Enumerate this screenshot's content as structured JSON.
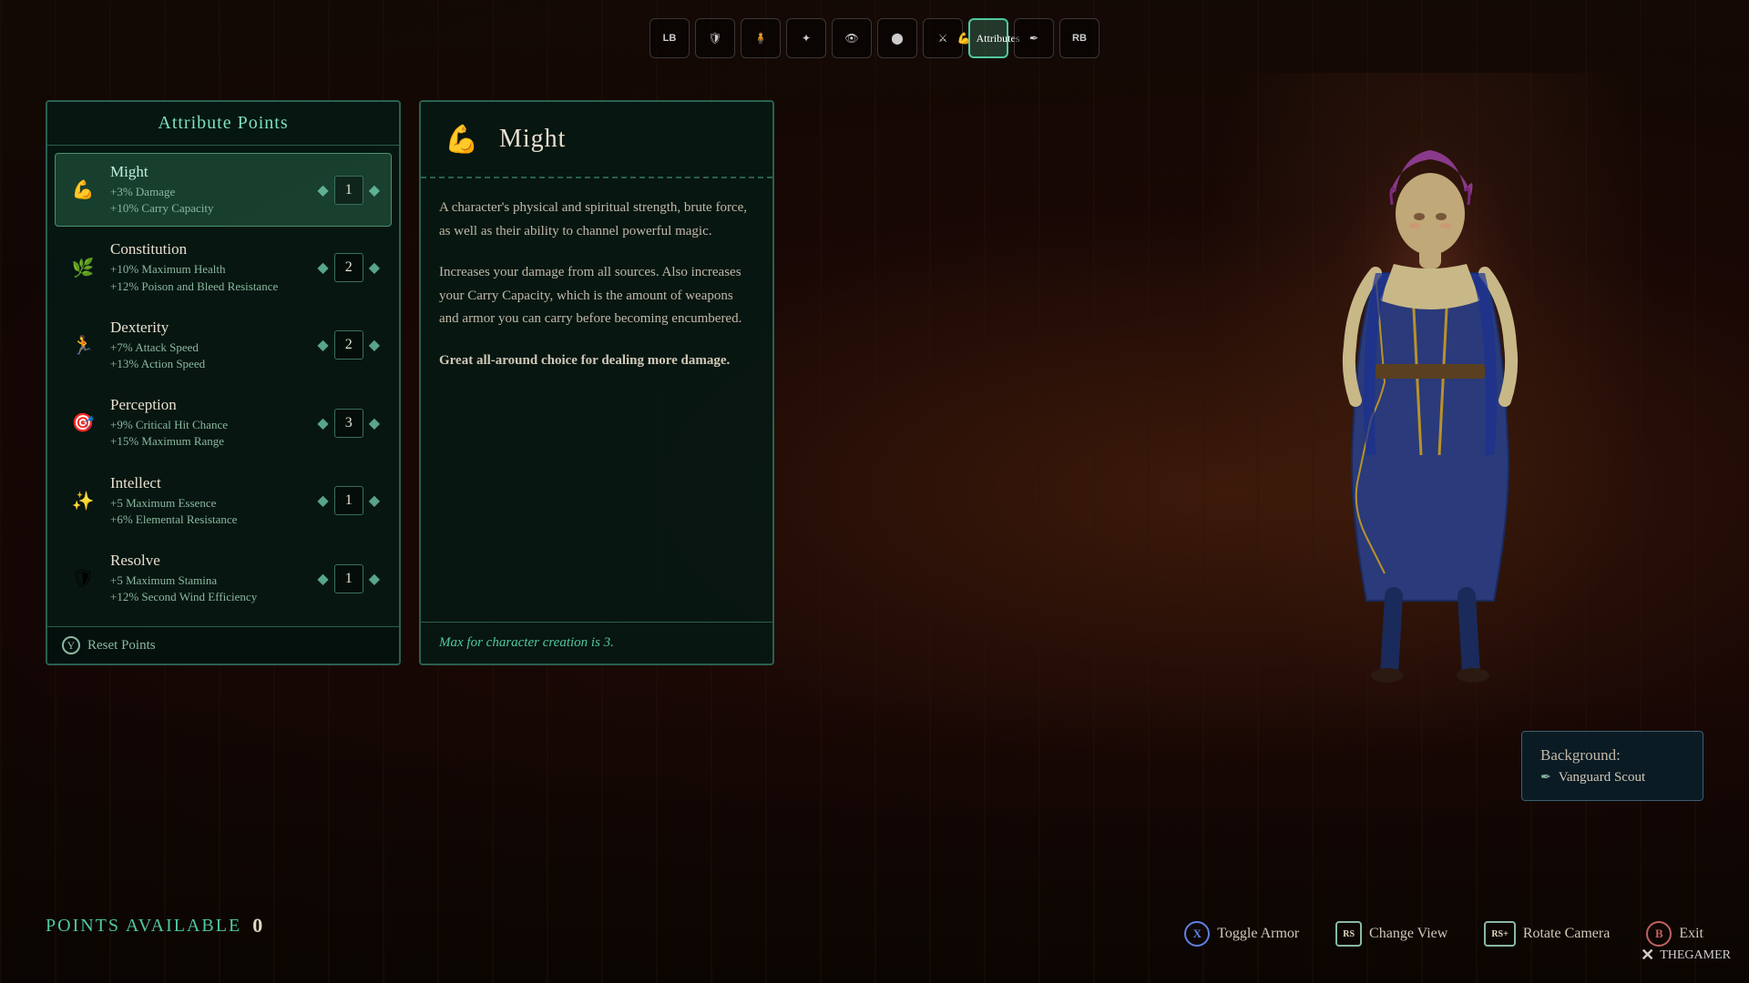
{
  "background": {
    "color": "#1a0a05"
  },
  "nav": {
    "buttons": [
      {
        "id": "lb",
        "label": "LB",
        "active": false
      },
      {
        "id": "shield",
        "icon": "🛡",
        "active": false
      },
      {
        "id": "person",
        "icon": "🧍",
        "active": false
      },
      {
        "id": "star",
        "icon": "✦",
        "active": false
      },
      {
        "id": "eye",
        "icon": "👁",
        "active": false
      },
      {
        "id": "circle",
        "icon": "⬤",
        "active": false
      },
      {
        "id": "sword",
        "icon": "⚔",
        "active": false
      },
      {
        "id": "attributes",
        "label": "Attributes",
        "icon": "💪",
        "active": true
      },
      {
        "id": "quill",
        "icon": "✒",
        "active": false
      },
      {
        "id": "rb",
        "label": "RB",
        "active": false
      }
    ]
  },
  "attributePanel": {
    "title": "Attribute Points",
    "attributes": [
      {
        "id": "might",
        "name": "Might",
        "icon": "💪",
        "bonuses": [
          "+3% Damage",
          "+10% Carry Capacity"
        ],
        "value": 1,
        "selected": true
      },
      {
        "id": "constitution",
        "name": "Constitution",
        "icon": "🌿",
        "bonuses": [
          "+10% Maximum Health",
          "+12% Poison and Bleed Resistance"
        ],
        "value": 2,
        "selected": false
      },
      {
        "id": "dexterity",
        "name": "Dexterity",
        "icon": "🏃",
        "bonuses": [
          "+7% Attack Speed",
          "+13% Action Speed"
        ],
        "value": 2,
        "selected": false
      },
      {
        "id": "perception",
        "name": "Perception",
        "icon": "🎯",
        "bonuses": [
          "+9% Critical Hit Chance",
          "+15% Maximum Range"
        ],
        "value": 3,
        "selected": false
      },
      {
        "id": "intellect",
        "name": "Intellect",
        "icon": "✨",
        "bonuses": [
          "+5 Maximum Essence",
          "+6% Elemental Resistance"
        ],
        "value": 1,
        "selected": false
      },
      {
        "id": "resolve",
        "name": "Resolve",
        "icon": "🛡",
        "bonuses": [
          "+5 Maximum Stamina",
          "+12% Second Wind Efficiency"
        ],
        "value": 1,
        "selected": false
      }
    ],
    "resetButton": "Reset Points"
  },
  "detailPanel": {
    "icon": "💪",
    "title": "Might",
    "description": "A character's physical and spiritual strength, brute force, as well as their ability to channel powerful magic.",
    "mechanics": "Increases your damage from all sources. Also increases your Carry Capacity, which is the amount of weapons and armor you can carry before becoming encumbered.",
    "highlight": "Great all-around choice for dealing more damage.",
    "footer": "Max for character creation is 3."
  },
  "pointsAvailable": {
    "label": "POINTS AVAILABLE",
    "value": "0"
  },
  "bottomBar": {
    "buttons": [
      {
        "key": "X",
        "label": "Toggle Armor",
        "style": "x"
      },
      {
        "key": "RS",
        "label": "Change View",
        "style": "rs"
      },
      {
        "key": "RS+",
        "label": "Rotate Camera",
        "style": "rs"
      },
      {
        "key": "B",
        "label": "Exit",
        "style": "b"
      }
    ]
  },
  "backgroundCard": {
    "label": "Background:",
    "value": "Vanguard Scout"
  },
  "watermark": {
    "symbol": "✕",
    "text": "THEGAMER"
  }
}
